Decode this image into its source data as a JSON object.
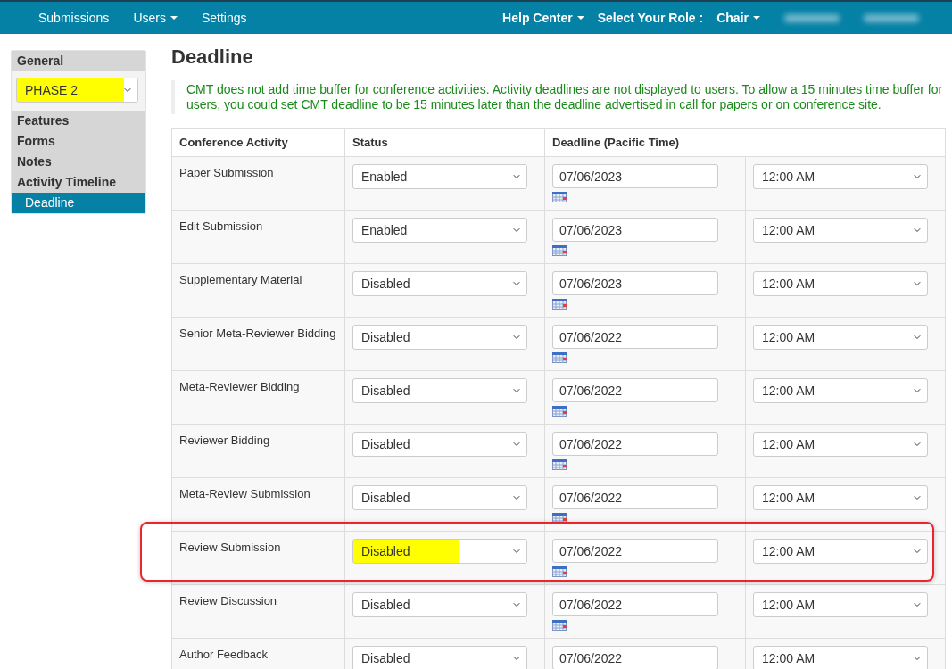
{
  "navbar": {
    "left_items": [
      {
        "label": "Submissions",
        "dropdown": false
      },
      {
        "label": "Users",
        "dropdown": true
      },
      {
        "label": "Settings",
        "dropdown": false
      }
    ],
    "right_items": [
      {
        "kind": "link",
        "label": "Help Center",
        "dropdown": true
      },
      {
        "kind": "text",
        "label": "Select Your Role :"
      },
      {
        "kind": "link",
        "label": "Chair",
        "dropdown": true
      },
      {
        "kind": "blurred"
      },
      {
        "kind": "blurred"
      }
    ]
  },
  "sidebar": {
    "items": [
      {
        "kind": "header",
        "label": "General",
        "selected": false
      },
      {
        "kind": "select",
        "value": "PHASE 2",
        "highlighted": true
      },
      {
        "kind": "item",
        "label": "Features",
        "selected": false
      },
      {
        "kind": "item",
        "label": "Forms",
        "selected": false
      },
      {
        "kind": "item",
        "label": "Notes",
        "selected": false
      },
      {
        "kind": "item",
        "label": "Activity Timeline",
        "selected": false
      },
      {
        "kind": "subitem",
        "label": "Deadline",
        "selected": true
      }
    ]
  },
  "main": {
    "title": "Deadline",
    "note": "CMT does not add time buffer for conference activities. Activity deadlines are not displayed to users. To allow a 15 minutes time buffer for users, you could set CMT deadline to be 15 minutes later than the deadline advertised in call for papers or on conference site.",
    "table": {
      "columns": [
        "Conference Activity",
        "Status",
        "Deadline (Pacific Time)"
      ],
      "rows": [
        {
          "activity": "Paper Submission",
          "status": "Enabled",
          "date": "07/06/2023",
          "time": "12:00 AM",
          "highlighted": false,
          "outlined": false
        },
        {
          "activity": "Edit Submission",
          "status": "Enabled",
          "date": "07/06/2023",
          "time": "12:00 AM",
          "highlighted": false,
          "outlined": false
        },
        {
          "activity": "Supplementary Material",
          "status": "Disabled",
          "date": "07/06/2023",
          "time": "12:00 AM",
          "highlighted": false,
          "outlined": false
        },
        {
          "activity": "Senior Meta-Reviewer Bidding",
          "status": "Disabled",
          "date": "07/06/2022",
          "time": "12:00 AM",
          "highlighted": false,
          "outlined": false
        },
        {
          "activity": "Meta-Reviewer Bidding",
          "status": "Disabled",
          "date": "07/06/2022",
          "time": "12:00 AM",
          "highlighted": false,
          "outlined": false
        },
        {
          "activity": "Reviewer Bidding",
          "status": "Disabled",
          "date": "07/06/2022",
          "time": "12:00 AM",
          "highlighted": false,
          "outlined": false
        },
        {
          "activity": "Meta-Review Submission",
          "status": "Disabled",
          "date": "07/06/2022",
          "time": "12:00 AM",
          "highlighted": false,
          "outlined": false
        },
        {
          "activity": "Review Submission",
          "status": "Disabled",
          "date": "07/06/2022",
          "time": "12:00 AM",
          "highlighted": true,
          "outlined": true
        },
        {
          "activity": "Review Discussion",
          "status": "Disabled",
          "date": "07/06/2022",
          "time": "12:00 AM",
          "highlighted": false,
          "outlined": false
        },
        {
          "activity": "Author Feedback",
          "status": "Disabled",
          "date": "07/06/2022",
          "time": "12:00 AM",
          "highlighted": false,
          "outlined": false
        }
      ]
    }
  }
}
